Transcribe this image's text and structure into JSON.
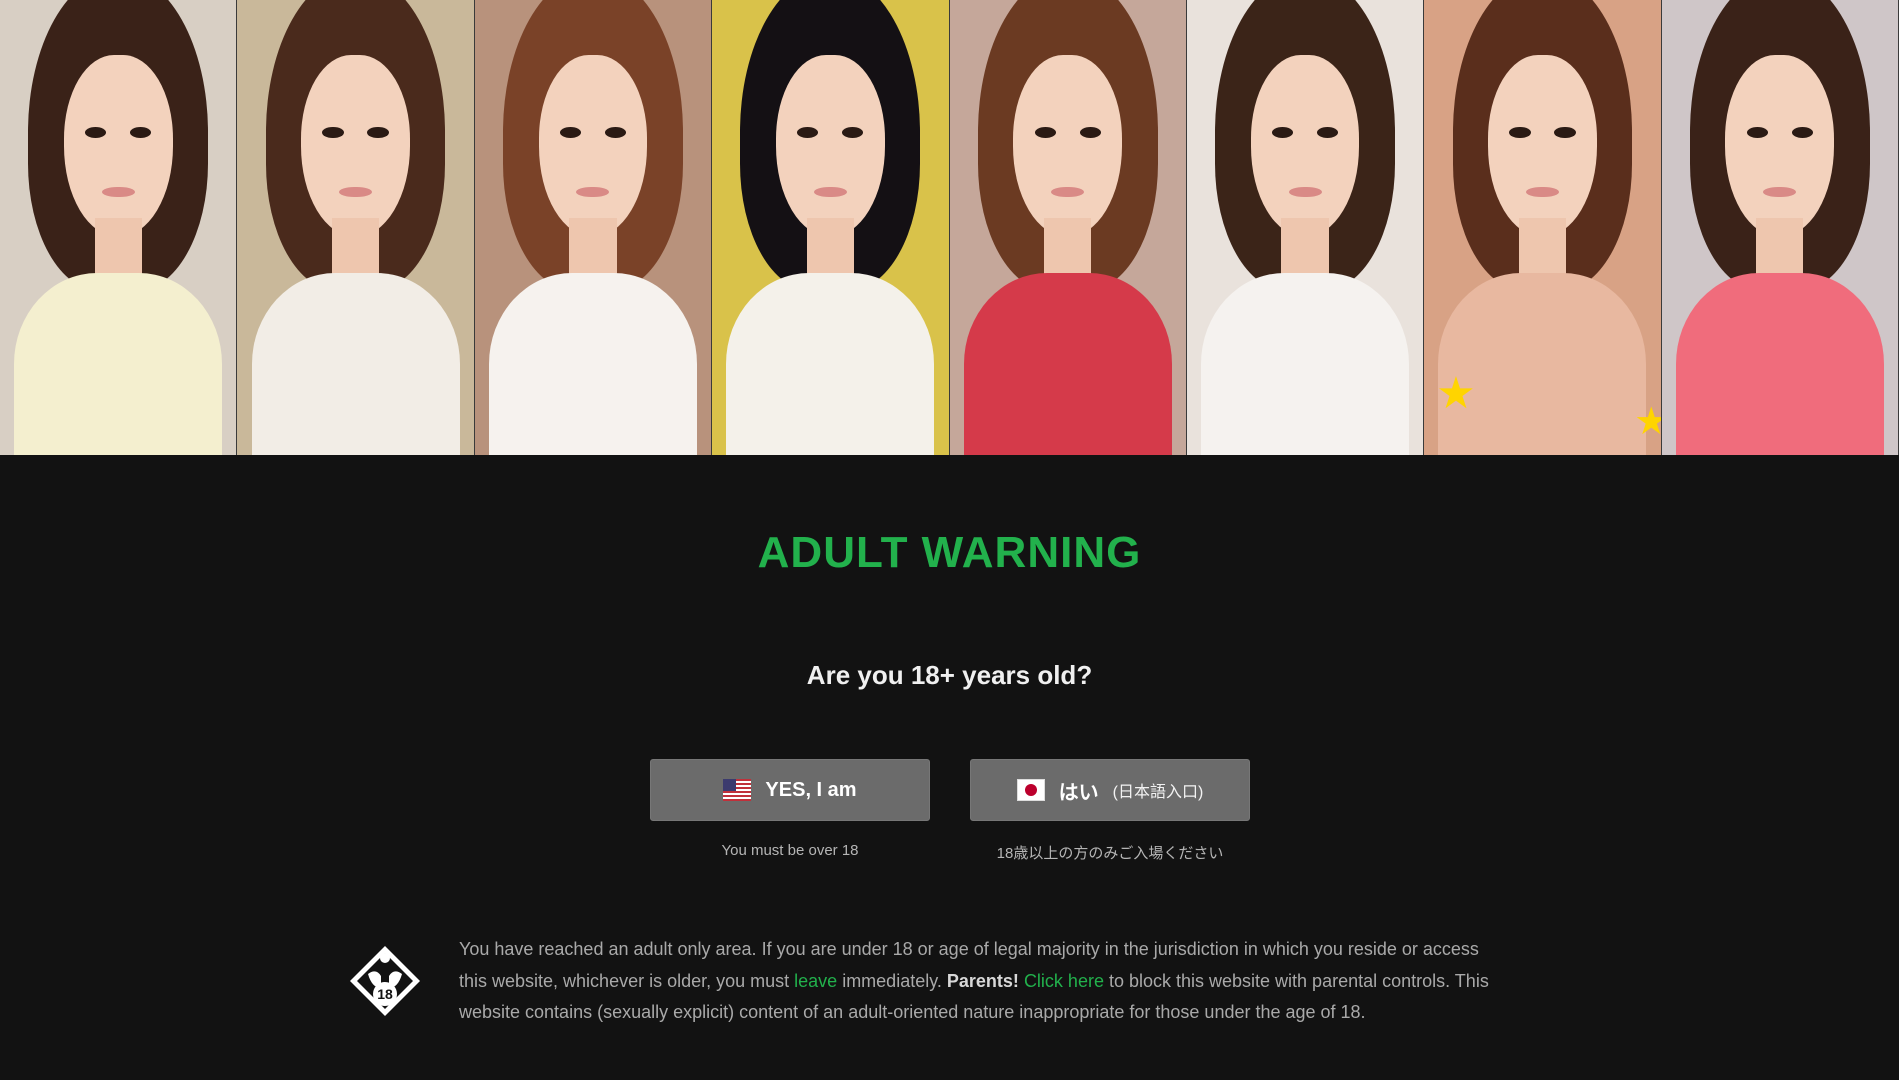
{
  "banner": {
    "portraits": [
      {
        "hair": "#3a2218",
        "top": "#f4efcf",
        "bg": "#d8cfc4"
      },
      {
        "hair": "#4a2a1c",
        "top": "#f2ede6",
        "bg": "#c9b89a"
      },
      {
        "hair": "#7a4228",
        "top": "#f6f2ee",
        "bg": "#b8927c"
      },
      {
        "hair": "#141014",
        "top": "#f4f1ea",
        "bg": "#d9c24a"
      },
      {
        "hair": "#6b3a22",
        "top": "#d53a4a",
        "bg": "#c5a79a"
      },
      {
        "hair": "#3b2418",
        "top": "#f5f2ef",
        "bg": "#e9e2dc"
      },
      {
        "hair": "#5a2e1c",
        "top": "#e8b8a0",
        "bg": "#d8a285"
      },
      {
        "hair": "#3a2218",
        "top": "#f06c7c",
        "bg": "#cfc6c8"
      }
    ],
    "star_color": "#ffd400"
  },
  "warning": {
    "title": "ADULT WARNING",
    "title_color": "#22b14c",
    "question": "Are you 18+ years old?"
  },
  "buttons": {
    "yes": {
      "label": "YES, I am",
      "flag_icon": "us-flag-icon",
      "note": "You must be over 18"
    },
    "jp": {
      "label": "はい",
      "sub_label": "(日本語入口)",
      "flag_icon": "japan-flag-icon",
      "note": "18歳以上の方のみご入場ください"
    }
  },
  "disclaimer": {
    "badge_icon": "age-18-badge-icon",
    "text_1": "You have reached an adult only area. If you are under 18 or age of legal majority in the jurisdiction in which you reside or access this website, whichever is older, you must ",
    "leave_link": "leave",
    "text_2": " immediately. ",
    "parents_label": "Parents!",
    "text_3": " ",
    "click_here_link": "Click here",
    "text_4": " to block this website with parental controls. This website contains (sexually explicit) content of an adult-oriented nature inappropriate for those under the age of 18."
  }
}
